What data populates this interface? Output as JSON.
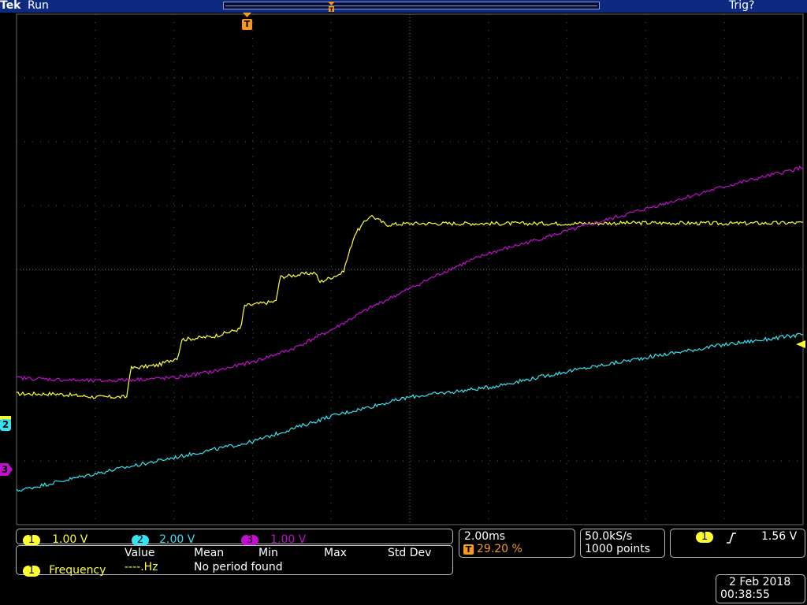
{
  "topbar": {
    "brand": "Tek",
    "acq_state": "Run",
    "trigger_status": "Trig?"
  },
  "trigger_position_marker": "T",
  "channels": [
    {
      "id": "1",
      "scale": "1.00 V",
      "color": "#ffff32"
    },
    {
      "id": "2",
      "scale": "2.00 V",
      "color": "#35e3f2"
    },
    {
      "id": "3",
      "scale": "1.00 V",
      "color": "#c20fd0"
    }
  ],
  "ground_markers": {
    "ch2": "2",
    "ch3": "3"
  },
  "measurements": {
    "headers": [
      "Value",
      "Mean",
      "Min",
      "Max",
      "Std Dev"
    ],
    "row": {
      "channel": "1",
      "name": "Frequency",
      "value": "----.Hz",
      "note": "No period found"
    }
  },
  "horizontal": {
    "time_per_div": "2.00ms",
    "trigger_marker": "T",
    "trigger_position": "29.20 %"
  },
  "acquisition": {
    "sample_rate": "50.0kS/s",
    "record_length": "1000 points"
  },
  "trigger": {
    "source": "1",
    "slope_icon": "rising-edge-icon",
    "level": "1.56 V"
  },
  "datetime": {
    "date": "2 Feb 2018",
    "time": "00:38:55"
  },
  "colors": {
    "ch1": "#ffff32",
    "ch2": "#35e3f2",
    "ch3": "#c20fd0",
    "trigger_marker": "#f79a1b",
    "topbar": "#0d2a80"
  },
  "chart_data": {
    "type": "line",
    "x_unit": "div",
    "xlim": [
      0,
      10
    ],
    "ylim": [
      -4,
      4
    ],
    "series": [
      {
        "name": "1",
        "x": [
          0,
          0.5,
          1,
          1.4,
          1.45,
          1.8,
          2.05,
          2.1,
          2.5,
          2.85,
          2.9,
          3.3,
          3.35,
          3.8,
          3.85,
          4.15,
          4.3,
          4.5,
          4.7,
          5,
          6,
          7,
          8,
          9,
          10
        ],
        "values": [
          -1.95,
          -1.95,
          -2.0,
          -2.0,
          -1.55,
          -1.5,
          -1.38,
          -1.1,
          -1.05,
          -0.93,
          -0.57,
          -0.5,
          -0.12,
          -0.05,
          -0.2,
          -0.05,
          0.55,
          0.85,
          0.7,
          0.72,
          0.72,
          0.72,
          0.73,
          0.72,
          0.73
        ]
      },
      {
        "name": "2",
        "x": [
          0,
          1,
          2,
          3,
          4,
          5,
          6,
          7,
          8,
          9,
          10
        ],
        "values": [
          -3.47,
          -3.2,
          -2.95,
          -2.7,
          -2.3,
          -2.0,
          -1.85,
          -1.6,
          -1.38,
          -1.18,
          -1.02
        ]
      },
      {
        "name": "3",
        "x": [
          0,
          1,
          2,
          2.5,
          3,
          3.5,
          4,
          4.5,
          5,
          5.5,
          6,
          7,
          8,
          9,
          10
        ],
        "values": [
          -1.7,
          -1.75,
          -1.7,
          -1.6,
          -1.45,
          -1.25,
          -0.95,
          -0.6,
          -0.3,
          0.0,
          0.25,
          0.6,
          0.95,
          1.3,
          1.6
        ]
      }
    ]
  }
}
